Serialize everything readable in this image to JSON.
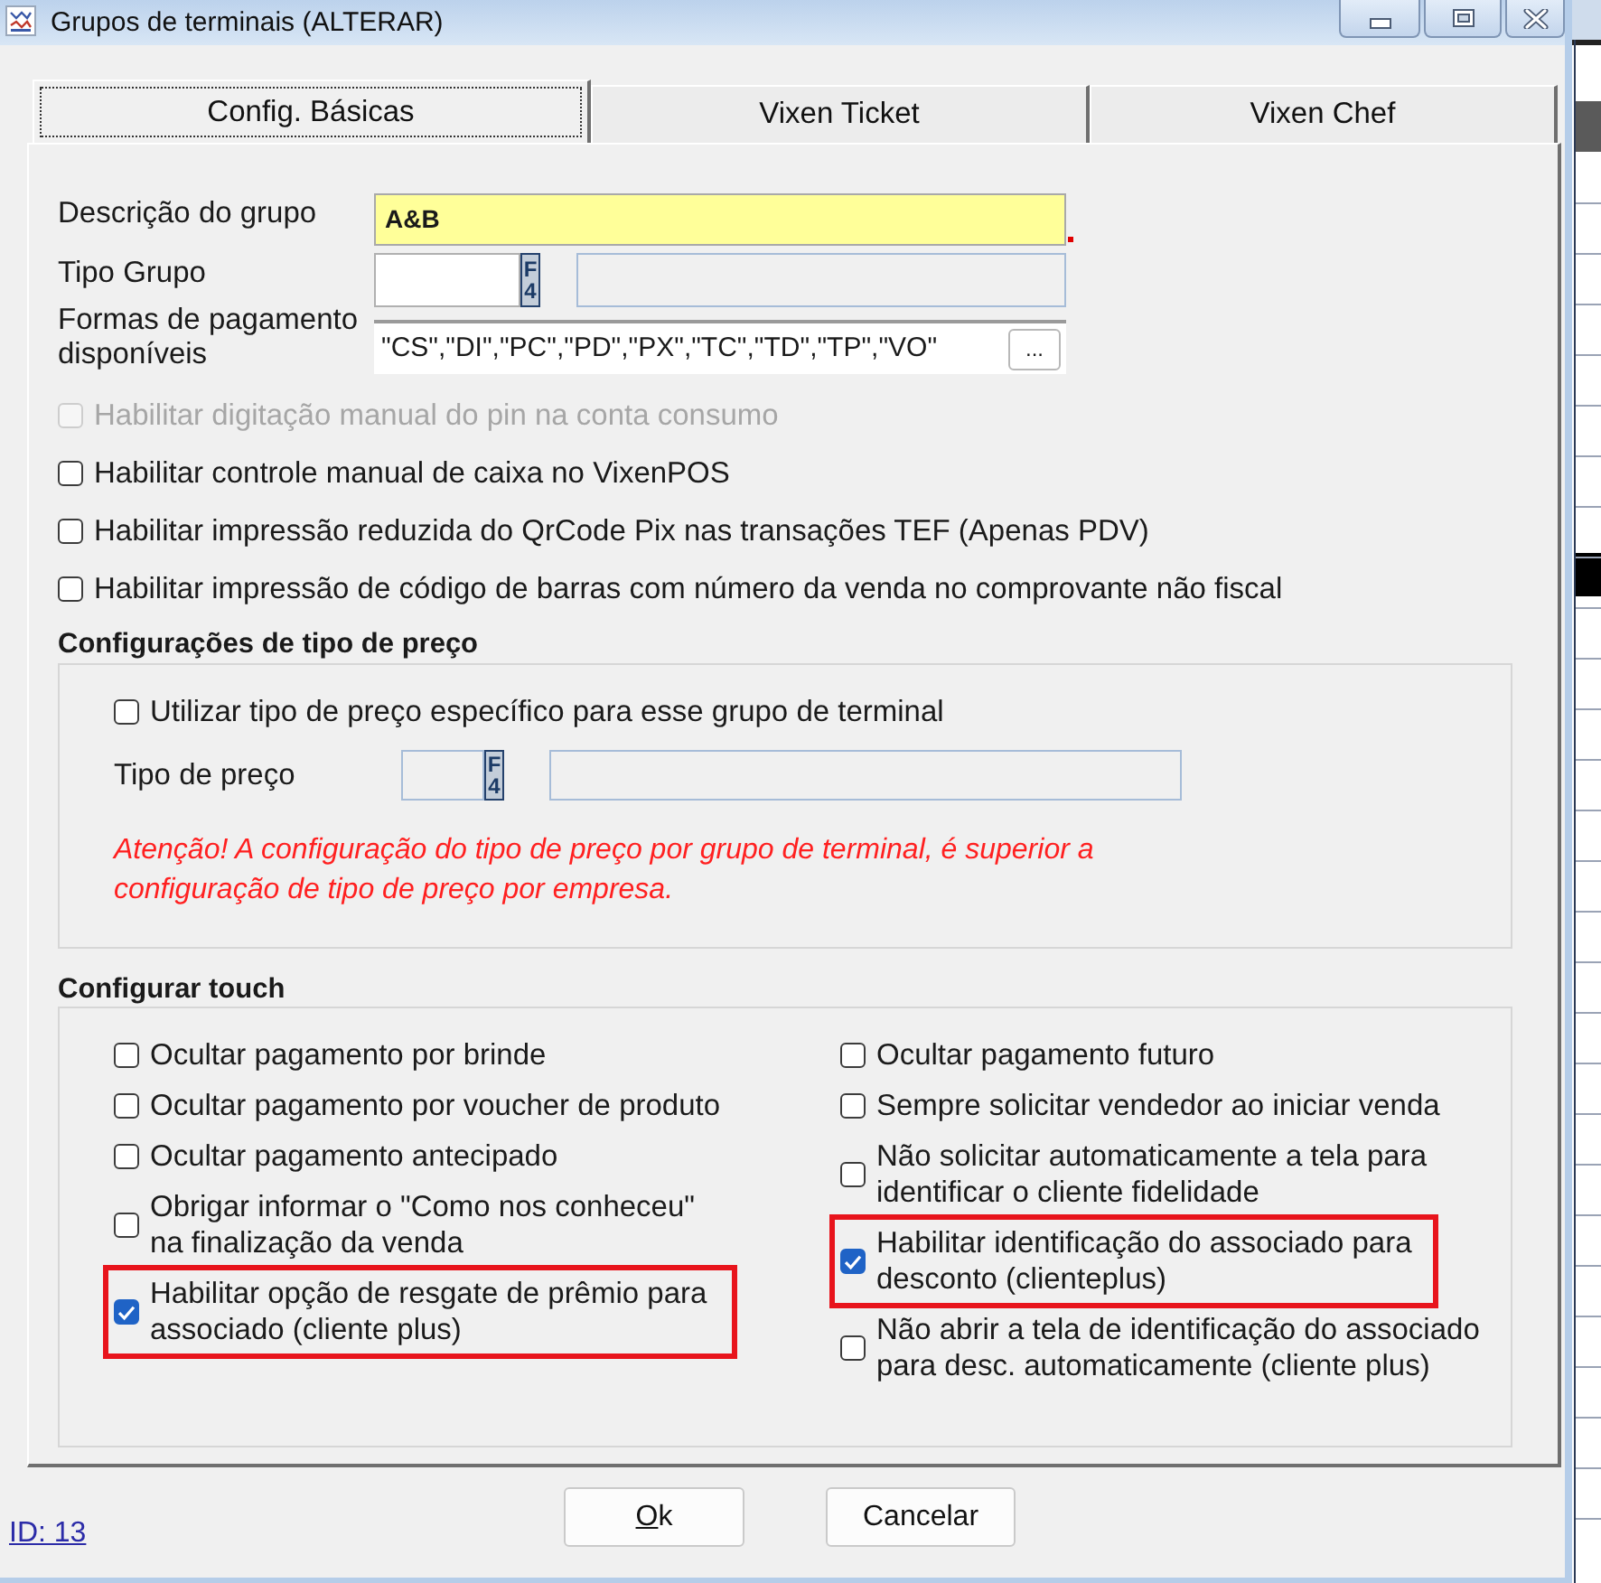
{
  "window": {
    "title": "Grupos de terminais (ALTERAR)"
  },
  "tabs": [
    {
      "label": "Config. Básicas",
      "selected": true
    },
    {
      "label": "Vixen Ticket",
      "selected": false
    },
    {
      "label": "Vixen Chef",
      "selected": false
    }
  ],
  "fields": [
    {
      "kind": "text",
      "label": "Descrição do grupo",
      "value": "A&B",
      "focused": true,
      "required": true
    },
    {
      "kind": "lookup",
      "label": "Tipo Grupo",
      "key_label": "F4",
      "disabled": false
    },
    {
      "kind": "list",
      "label": "Formas de pagamento disponíveis",
      "value": "\"CS\",\"DI\",\"PC\",\"PD\",\"PX\",\"TC\",\"TD\",\"TP\",\"VO\"",
      "button": "..."
    }
  ],
  "options": [
    {
      "label": "Habilitar digitação manual do pin na conta consumo",
      "checked": false,
      "disabled": true
    },
    {
      "label": "Habilitar controle manual de caixa no VixenPOS",
      "checked": false,
      "disabled": false
    },
    {
      "label": "Habilitar impressão reduzida do QrCode Pix nas transações TEF (Apenas PDV)",
      "checked": false,
      "disabled": false
    },
    {
      "label": "Habilitar impressão de código de barras com número da venda no comprovante não fiscal",
      "checked": false,
      "disabled": false
    }
  ],
  "price_type": {
    "title": "Configurações de tipo de preço",
    "option": {
      "label": "Utilizar tipo de preço específico para esse grupo de terminal",
      "checked": false
    },
    "lookup": {
      "label": "Tipo de preço",
      "key_label": "F4",
      "disabled": true
    },
    "warning": "Atenção! A configuração do tipo de preço por grupo de terminal, é superior a configuração de tipo de preço por empresa."
  },
  "touch": {
    "title": "Configurar touch",
    "columns": [
      [
        {
          "label": "Ocultar pagamento por brinde",
          "checked": false,
          "highlighted": false
        },
        {
          "label": "Ocultar pagamento por voucher de produto",
          "checked": false,
          "highlighted": false
        },
        {
          "label": "Ocultar pagamento antecipado",
          "checked": false,
          "highlighted": false
        },
        {
          "label": "Obrigar informar o \"Como nos conheceu\" na finalização da venda",
          "checked": false,
          "highlighted": false
        },
        {
          "label": "Habilitar opção de resgate de prêmio para associado (cliente plus)",
          "checked": true,
          "highlighted": true
        }
      ],
      [
        {
          "label": "Ocultar pagamento futuro",
          "checked": false,
          "highlighted": false
        },
        {
          "label": "Sempre solicitar vendedor ao iniciar venda",
          "checked": false,
          "highlighted": false
        },
        {
          "label": "Não solicitar automaticamente a tela para identificar o cliente fidelidade",
          "checked": false,
          "highlighted": false
        },
        {
          "label": "Habilitar identificação do associado para desconto (clienteplus)",
          "checked": true,
          "highlighted": true
        },
        {
          "label": "Não abrir a tela de identificação do associado para desc. automaticamente (cliente plus)",
          "checked": false,
          "highlighted": false
        }
      ]
    ]
  },
  "buttons": [
    {
      "label": "Ok",
      "underline_first": true
    },
    {
      "label": "Cancelar",
      "underline_first": false
    }
  ],
  "id_link": "ID: 13"
}
